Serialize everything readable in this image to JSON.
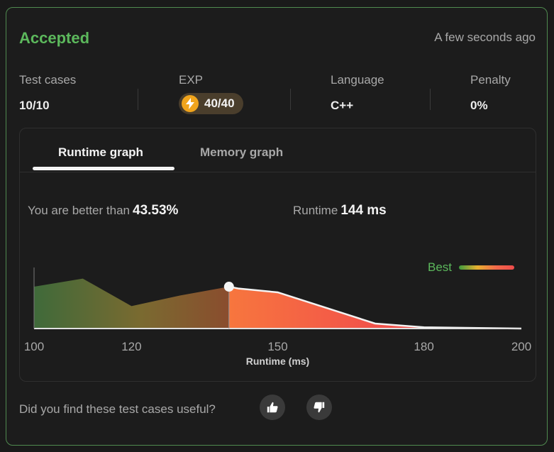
{
  "header": {
    "status": "Accepted",
    "time_ago": "A few seconds ago"
  },
  "stats": {
    "test_cases": {
      "label": "Test cases",
      "value": "10/10"
    },
    "exp": {
      "label": "EXP",
      "value": "40/40"
    },
    "language": {
      "label": "Language",
      "value": "C++"
    },
    "penalty": {
      "label": "Penalty",
      "value": "0%"
    }
  },
  "tabs": {
    "runtime": "Runtime graph",
    "memory": "Memory graph"
  },
  "metrics": {
    "better_label": "You are better than",
    "better_value": "43.53%",
    "runtime_label": "Runtime",
    "runtime_value": "144 ms"
  },
  "legend": {
    "label": "Best"
  },
  "chart_data": {
    "type": "area",
    "xlabel": "Runtime (ms)",
    "xlim": [
      100,
      200
    ],
    "xticks": [
      100,
      120,
      150,
      180,
      200
    ],
    "x": [
      100,
      110,
      120,
      130,
      140,
      142,
      150,
      170,
      180,
      200
    ],
    "y": [
      0.67,
      0.8,
      0.36,
      0.53,
      0.67,
      0.64,
      0.58,
      0.08,
      0.02,
      0.0
    ],
    "ylim": [
      0,
      1
    ],
    "marker": {
      "x": 140,
      "y": 0.67
    },
    "colors": {
      "best": "#3e9b3e",
      "mid": "#e8b030",
      "worst": "#ee4b4b"
    }
  },
  "feedback": {
    "question": "Did you find these test cases useful?"
  }
}
